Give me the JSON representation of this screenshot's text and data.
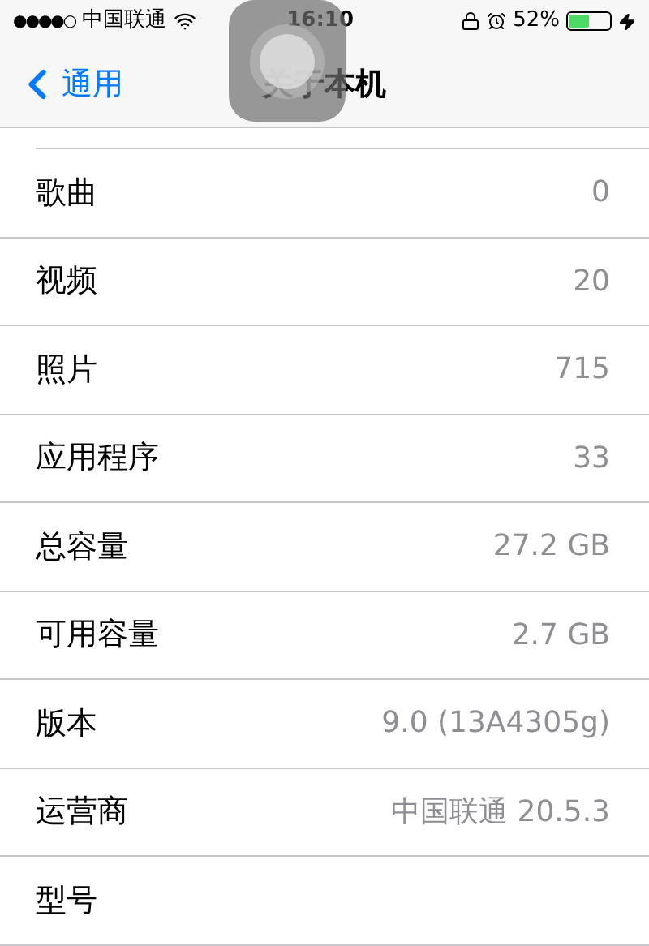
{
  "status_bar": {
    "signal": "●●●●○",
    "carrier": "中国联通",
    "time": "16:10",
    "battery": "52%"
  },
  "nav": {
    "back": "通用",
    "title": "关于本机"
  },
  "rows": [
    {
      "label": "歌曲",
      "value": "0"
    },
    {
      "label": "视频",
      "value": "20"
    },
    {
      "label": "照片",
      "value": "715"
    },
    {
      "label": "应用程序",
      "value": "33"
    },
    {
      "label": "总容量",
      "value": "27.2 GB"
    },
    {
      "label": "可用容量",
      "value": "2.7 GB"
    },
    {
      "label": "版本",
      "value": "9.0 (13A4305g)"
    },
    {
      "label": "运营商",
      "value": "中国联通 20.5.3"
    },
    {
      "label": "型号"
    }
  ]
}
